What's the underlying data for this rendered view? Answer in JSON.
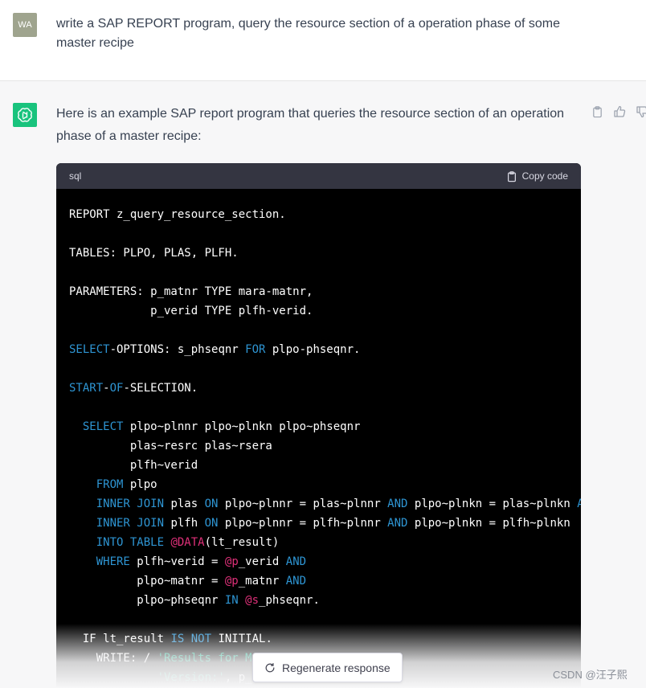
{
  "user": {
    "avatar_text": "WA",
    "message": "write a SAP REPORT program, query the resource section of a operation phase of some master recipe"
  },
  "assistant": {
    "avatar_icon": "openai-logo-icon",
    "message": "Here is an example SAP report program that queries the resource section of an operation phase of a master recipe:",
    "actions": [
      "clipboard-icon",
      "thumbs-up-icon",
      "thumbs-down-icon"
    ]
  },
  "code": {
    "language": "sql",
    "copy_label": "Copy code",
    "lines": [
      [
        [
          "plain",
          "REPORT z_query_resource_section."
        ]
      ],
      [],
      [
        [
          "plain",
          "TABLES: PLPO, PLAS, PLFH."
        ]
      ],
      [],
      [
        [
          "plain",
          "PARAMETERS: p_matnr TYPE mara-matnr,"
        ]
      ],
      [
        [
          "plain",
          "            p_verid TYPE plfh-verid."
        ]
      ],
      [],
      [
        [
          "kw",
          "SELECT"
        ],
        [
          "plain",
          "-OPTIONS: s_phseqnr "
        ],
        [
          "kw",
          "FOR"
        ],
        [
          "plain",
          " plpo-phseqnr."
        ]
      ],
      [],
      [
        [
          "kw",
          "START"
        ],
        [
          "plain",
          "-"
        ],
        [
          "kw",
          "OF"
        ],
        [
          "plain",
          "-SELECTION."
        ]
      ],
      [],
      [
        [
          "plain",
          "  "
        ],
        [
          "kw",
          "SELECT"
        ],
        [
          "plain",
          " plpo~plnnr plpo~plnkn plpo~phseqnr"
        ]
      ],
      [
        [
          "plain",
          "         plas~resrc plas~rsera"
        ]
      ],
      [
        [
          "plain",
          "         plfh~verid"
        ]
      ],
      [
        [
          "plain",
          "    "
        ],
        [
          "kw",
          "FROM"
        ],
        [
          "plain",
          " plpo"
        ]
      ],
      [
        [
          "plain",
          "    "
        ],
        [
          "kw",
          "INNER JOIN"
        ],
        [
          "plain",
          " plas "
        ],
        [
          "kw",
          "ON"
        ],
        [
          "plain",
          " plpo~plnnr = plas~plnnr "
        ],
        [
          "kw",
          "AND"
        ],
        [
          "plain",
          " plpo~plnkn = plas~plnkn "
        ],
        [
          "kw",
          "A"
        ]
      ],
      [
        [
          "plain",
          "    "
        ],
        [
          "kw",
          "INNER JOIN"
        ],
        [
          "plain",
          " plfh "
        ],
        [
          "kw",
          "ON"
        ],
        [
          "plain",
          " plpo~plnnr = plfh~plnnr "
        ],
        [
          "kw",
          "AND"
        ],
        [
          "plain",
          " plpo~plnkn = plfh~plnkn"
        ]
      ],
      [
        [
          "plain",
          "    "
        ],
        [
          "kw",
          "INTO TABLE"
        ],
        [
          "plain",
          " "
        ],
        [
          "var",
          "@DATA"
        ],
        [
          "plain",
          "(lt_result)"
        ]
      ],
      [
        [
          "plain",
          "    "
        ],
        [
          "kw",
          "WHERE"
        ],
        [
          "plain",
          " plfh~verid = "
        ],
        [
          "var",
          "@p"
        ],
        [
          "plain",
          "_verid "
        ],
        [
          "kw",
          "AND"
        ]
      ],
      [
        [
          "plain",
          "          plpo~matnr = "
        ],
        [
          "var",
          "@p"
        ],
        [
          "plain",
          "_matnr "
        ],
        [
          "kw",
          "AND"
        ]
      ],
      [
        [
          "plain",
          "          plpo~phseqnr "
        ],
        [
          "kw",
          "IN"
        ],
        [
          "plain",
          " "
        ],
        [
          "var",
          "@s"
        ],
        [
          "plain",
          "_phseqnr."
        ]
      ],
      [],
      [
        [
          "plain",
          "  IF lt_result "
        ],
        [
          "kw",
          "IS NOT"
        ],
        [
          "plain",
          " INITIAL."
        ]
      ],
      [
        [
          "plain",
          "    WRITE: / "
        ],
        [
          "str",
          "'Results for M"
        ]
      ],
      [
        [
          "plain",
          "             "
        ],
        [
          "str",
          "'Version:'"
        ],
        [
          "plain",
          ", p_"
        ]
      ]
    ]
  },
  "footer": {
    "regenerate_label": "Regenerate response",
    "watermark": "CSDN @汪子熙"
  }
}
